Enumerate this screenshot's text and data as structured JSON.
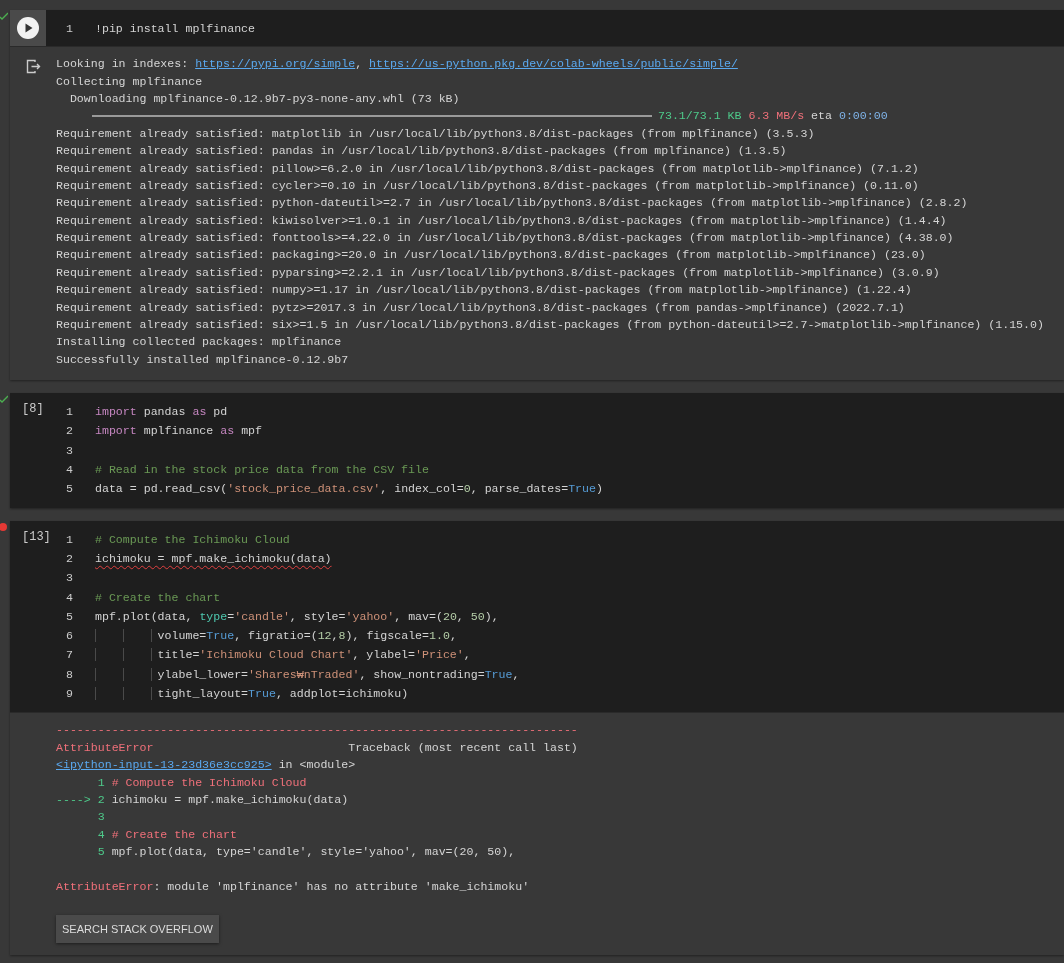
{
  "cells": [
    {
      "kind": "run",
      "error": false,
      "lines": [
        {
          "number": "1",
          "tokens": [
            {
              "kind": "plain",
              "text": "!pip install mplfinance"
            }
          ]
        }
      ],
      "output": {
        "lines": [
          {
            "kind": "text",
            "tokens": [
              {
                "kind": "plain",
                "text": "Looking in indexes: "
              },
              {
                "kind": "link",
                "text": "https://pypi.org/simple"
              },
              {
                "kind": "plain",
                "text": ", "
              },
              {
                "kind": "link",
                "text": "https://us-python.pkg.dev/colab-wheels/public/simple/"
              }
            ]
          },
          {
            "kind": "text",
            "tokens": [
              {
                "kind": "plain",
                "text": "Collecting mplfinance"
              }
            ]
          },
          {
            "kind": "text",
            "tokens": [
              {
                "kind": "plain",
                "text": "  Downloading mplfinance-0.12.9b7-py3-none-any.whl (73 kB)"
              }
            ]
          },
          {
            "kind": "progress",
            "level": 1,
            "tokens": [
              {
                "kind": "green",
                "text": "73.1/73.1 KB"
              },
              {
                "kind": "red",
                "text": " 6.3 MB/s"
              },
              {
                "kind": "plain",
                "text": " eta "
              },
              {
                "kind": "blue",
                "text": "0:00:00"
              }
            ]
          },
          {
            "kind": "text",
            "tokens": [
              {
                "kind": "plain",
                "text": "Requirement already satisfied: matplotlib in /usr/local/lib/python3.8/dist-packages (from mplfinance) (3.5.3)"
              }
            ]
          },
          {
            "kind": "text",
            "tokens": [
              {
                "kind": "plain",
                "text": "Requirement already satisfied: pandas in /usr/local/lib/python3.8/dist-packages (from mplfinance) (1.3.5)"
              }
            ]
          },
          {
            "kind": "text",
            "tokens": [
              {
                "kind": "plain",
                "text": "Requirement already satisfied: pillow>=6.2.0 in /usr/local/lib/python3.8/dist-packages (from matplotlib->mplfinance) (7.1.2)"
              }
            ]
          },
          {
            "kind": "text",
            "tokens": [
              {
                "kind": "plain",
                "text": "Requirement already satisfied: cycler>=0.10 in /usr/local/lib/python3.8/dist-packages (from matplotlib->mplfinance) (0.11.0)"
              }
            ]
          },
          {
            "kind": "text",
            "tokens": [
              {
                "kind": "plain",
                "text": "Requirement already satisfied: python-dateutil>=2.7 in /usr/local/lib/python3.8/dist-packages (from matplotlib->mplfinance) (2.8.2)"
              }
            ]
          },
          {
            "kind": "text",
            "tokens": [
              {
                "kind": "plain",
                "text": "Requirement already satisfied: kiwisolver>=1.0.1 in /usr/local/lib/python3.8/dist-packages (from matplotlib->mplfinance) (1.4.4)"
              }
            ]
          },
          {
            "kind": "text",
            "tokens": [
              {
                "kind": "plain",
                "text": "Requirement already satisfied: fonttools>=4.22.0 in /usr/local/lib/python3.8/dist-packages (from matplotlib->mplfinance) (4.38.0)"
              }
            ]
          },
          {
            "kind": "text",
            "tokens": [
              {
                "kind": "plain",
                "text": "Requirement already satisfied: packaging>=20.0 in /usr/local/lib/python3.8/dist-packages (from matplotlib->mplfinance) (23.0)"
              }
            ]
          },
          {
            "kind": "text",
            "tokens": [
              {
                "kind": "plain",
                "text": "Requirement already satisfied: pyparsing>=2.2.1 in /usr/local/lib/python3.8/dist-packages (from matplotlib->mplfinance) (3.0.9)"
              }
            ]
          },
          {
            "kind": "text",
            "tokens": [
              {
                "kind": "plain",
                "text": "Requirement already satisfied: numpy>=1.17 in /usr/local/lib/python3.8/dist-packages (from matplotlib->mplfinance) (1.22.4)"
              }
            ]
          },
          {
            "kind": "text",
            "tokens": [
              {
                "kind": "plain",
                "text": "Requirement already satisfied: pytz>=2017.3 in /usr/local/lib/python3.8/dist-packages (from pandas->mplfinance) (2022.7.1)"
              }
            ]
          },
          {
            "kind": "text",
            "tokens": [
              {
                "kind": "plain",
                "text": "Requirement already satisfied: six>=1.5 in /usr/local/lib/python3.8/dist-packages (from python-dateutil>=2.7->matplotlib->mplfinance) (1.15.0)"
              }
            ]
          },
          {
            "kind": "text",
            "tokens": [
              {
                "kind": "plain",
                "text": "Installing collected packages: mplfinance"
              }
            ]
          },
          {
            "kind": "text",
            "tokens": [
              {
                "kind": "plain",
                "text": "Successfully installed mplfinance-0.12.9b7"
              }
            ]
          }
        ]
      }
    },
    {
      "kind": "prompt",
      "prompt": "[8]",
      "error": false,
      "lines": [
        {
          "number": "1",
          "tokens": [
            {
              "kind": "keyword",
              "text": "import"
            },
            {
              "kind": "plain",
              "text": " pandas "
            },
            {
              "kind": "keyword",
              "text": "as"
            },
            {
              "kind": "plain",
              "text": " pd"
            }
          ]
        },
        {
          "number": "2",
          "tokens": [
            {
              "kind": "keyword",
              "text": "import"
            },
            {
              "kind": "plain",
              "text": " mplfinance "
            },
            {
              "kind": "keyword",
              "text": "as"
            },
            {
              "kind": "plain",
              "text": " mpf"
            }
          ]
        },
        {
          "number": "3"
        },
        {
          "number": "4",
          "tokens": [
            {
              "kind": "comment",
              "text": "# Read in the stock price data from the CSV file"
            }
          ]
        },
        {
          "number": "5",
          "tokens": [
            {
              "kind": "plain",
              "text": "data = pd.read_csv("
            },
            {
              "kind": "string",
              "text": "'stock_price_data.csv'"
            },
            {
              "kind": "plain",
              "text": ", index_col="
            },
            {
              "kind": "number",
              "text": "0"
            },
            {
              "kind": "plain",
              "text": ", parse_dates="
            },
            {
              "kind": "constant",
              "text": "True"
            },
            {
              "kind": "plain",
              "text": ")"
            }
          ]
        }
      ]
    },
    {
      "kind": "prompt",
      "prompt": "[13]",
      "error": true,
      "lines": [
        {
          "number": "1",
          "tokens": [
            {
              "kind": "comment",
              "text": "# Compute the Ichimoku Cloud"
            }
          ]
        },
        {
          "number": "2",
          "flagged": true,
          "tokens": [
            {
              "kind": "plain",
              "text": "ichimoku = mpf.make_ichimoku(data)"
            }
          ]
        },
        {
          "number": "3"
        },
        {
          "number": "4",
          "tokens": [
            {
              "kind": "comment",
              "text": "# Create the chart"
            }
          ]
        },
        {
          "number": "5",
          "tokens": [
            {
              "kind": "plain",
              "text": "mpf.plot(data, "
            },
            {
              "kind": "param",
              "text": "type"
            },
            {
              "kind": "plain",
              "text": "="
            },
            {
              "kind": "string",
              "text": "'candle'"
            },
            {
              "kind": "plain",
              "text": ", style="
            },
            {
              "kind": "string",
              "text": "'yahoo'"
            },
            {
              "kind": "plain",
              "text": ", mav=("
            },
            {
              "kind": "number",
              "text": "20"
            },
            {
              "kind": "plain",
              "text": ", "
            },
            {
              "kind": "number",
              "text": "50"
            },
            {
              "kind": "plain",
              "text": "),"
            }
          ]
        },
        {
          "number": "6",
          "guides": true,
          "tokens": [
            {
              "kind": "plain",
              "text": "volume="
            },
            {
              "kind": "constant",
              "text": "True"
            },
            {
              "kind": "plain",
              "text": ", figratio=("
            },
            {
              "kind": "number",
              "text": "12"
            },
            {
              "kind": "plain",
              "text": ","
            },
            {
              "kind": "number",
              "text": "8"
            },
            {
              "kind": "plain",
              "text": "), figscale="
            },
            {
              "kind": "number",
              "text": "1.0"
            },
            {
              "kind": "plain",
              "text": ","
            }
          ]
        },
        {
          "number": "7",
          "guides": true,
          "tokens": [
            {
              "kind": "plain",
              "text": "title="
            },
            {
              "kind": "string",
              "text": "'Ichimoku Cloud Chart'"
            },
            {
              "kind": "plain",
              "text": ", ylabel="
            },
            {
              "kind": "string",
              "text": "'Price'"
            },
            {
              "kind": "plain",
              "text": ","
            }
          ]
        },
        {
          "number": "8",
          "guides": true,
          "tokens": [
            {
              "kind": "plain",
              "text": "ylabel_lower="
            },
            {
              "kind": "string",
              "text": "'Shares₩nTraded'"
            },
            {
              "kind": "plain",
              "text": ", show_nontrading="
            },
            {
              "kind": "constant",
              "text": "True"
            },
            {
              "kind": "plain",
              "text": ","
            }
          ]
        },
        {
          "number": "9",
          "guides": true,
          "tokens": [
            {
              "kind": "plain",
              "text": "tight_layout="
            },
            {
              "kind": "constant",
              "text": "True"
            },
            {
              "kind": "plain",
              "text": ", addplot=ichimoku)"
            }
          ]
        }
      ],
      "output": {
        "lines": [
          {
            "kind": "text",
            "tokens": [
              {
                "kind": "red",
                "text": "---------------------------------------------------------------------------"
              }
            ]
          },
          {
            "kind": "text",
            "tokens": [
              {
                "kind": "red",
                "text": "AttributeError"
              },
              {
                "kind": "plain",
                "text": "                            Traceback (most recent call last)"
              }
            ]
          },
          {
            "kind": "text",
            "tokens": [
              {
                "kind": "link",
                "text": "<ipython-input-13-23d36e3cc925>"
              },
              {
                "kind": "plain",
                "text": " in <module>"
              }
            ]
          },
          {
            "kind": "text",
            "indented": true,
            "tokens": [
              {
                "kind": "green",
                "text": "1"
              },
              {
                "kind": "red",
                "text": " # Compute the Ichimoku Cloud"
              }
            ]
          },
          {
            "kind": "text",
            "tokens": [
              {
                "kind": "green",
                "text": "----> 2"
              },
              {
                "kind": "plain",
                "text": " ichimoku = mpf.make_ichimoku(data)"
              }
            ]
          },
          {
            "kind": "text",
            "indented": true,
            "tokens": [
              {
                "kind": "green",
                "text": "3"
              }
            ]
          },
          {
            "kind": "text",
            "indented": true,
            "tokens": [
              {
                "kind": "green",
                "text": "4"
              },
              {
                "kind": "red",
                "text": " # Create the chart"
              }
            ]
          },
          {
            "kind": "text",
            "indented": true,
            "tokens": [
              {
                "kind": "green",
                "text": "5"
              },
              {
                "kind": "plain",
                "text": " mpf.plot(data, type='candle', style='yahoo', mav=(20, 50),"
              }
            ]
          },
          {
            "kind": "blank"
          },
          {
            "kind": "text",
            "tokens": [
              {
                "kind": "red",
                "text": "AttributeError"
              },
              {
                "kind": "plain",
                "text": ": module 'mplfinance' has no attribute 'make_ichimoku'"
              }
            ]
          }
        ],
        "button": "SEARCH STACK OVERFLOW"
      }
    }
  ]
}
